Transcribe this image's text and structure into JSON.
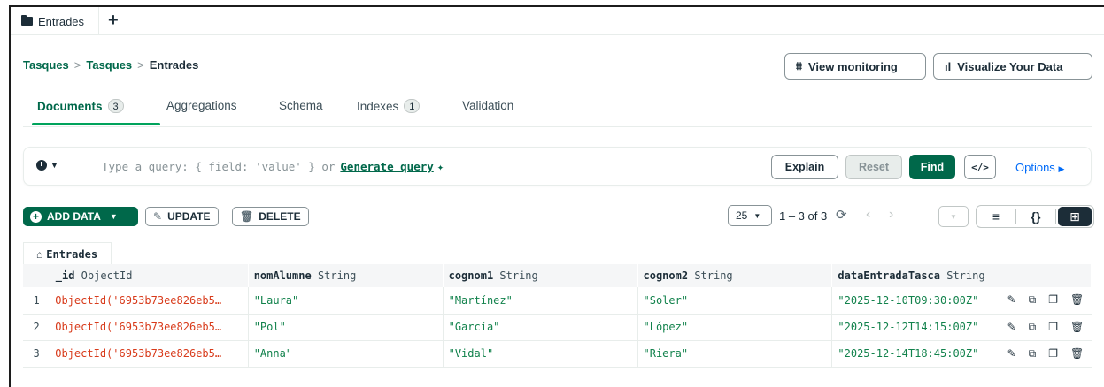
{
  "tabs": {
    "active_tab_label": "Entrades",
    "add_tab": "+"
  },
  "breadcrumb": {
    "db": "Tasques",
    "sep1": ">",
    "collection_parent": "Tasques",
    "sep2": ">",
    "current": "Entrades"
  },
  "header_buttons": {
    "monitoring": "View monitoring",
    "visualize": "Visualize Your Data"
  },
  "view_tabs": [
    {
      "label": "Documents",
      "badge": "3"
    },
    {
      "label": "Aggregations"
    },
    {
      "label": "Schema"
    },
    {
      "label": "Indexes",
      "badge": "1"
    },
    {
      "label": "Validation"
    }
  ],
  "query": {
    "placeholder": "Type a query: { field: 'value' } or",
    "generate": "Generate query",
    "explain": "Explain",
    "reset": "Reset",
    "find": "Find",
    "code": "</>",
    "options": "Options"
  },
  "actions": {
    "add_data": "ADD DATA",
    "update": "UPDATE",
    "delete": "DELETE"
  },
  "pagination": {
    "page_size": "25",
    "range": "1 – 3 of 3"
  },
  "collection_tag": "Entrades",
  "table": {
    "columns": [
      {
        "name": "_id",
        "type": "ObjectId"
      },
      {
        "name": "nomAlumne",
        "type": "String"
      },
      {
        "name": "cognom1",
        "type": "String"
      },
      {
        "name": "cognom2",
        "type": "String"
      },
      {
        "name": "dataEntradaTasca",
        "type": "String"
      }
    ],
    "rows": [
      {
        "n": "1",
        "id": "ObjectId('6953b73ee826eb5…",
        "nom": "\"Laura\"",
        "c1": "\"Martínez\"",
        "c2": "\"Soler\"",
        "date": "\"2025-12-10T09:30:00Z\""
      },
      {
        "n": "2",
        "id": "ObjectId('6953b73ee826eb5…",
        "nom": "\"Pol\"",
        "c1": "\"García\"",
        "c2": "\"López\"",
        "date": "\"2025-12-12T14:15:00Z\""
      },
      {
        "n": "3",
        "id": "ObjectId('6953b73ee826eb5…",
        "nom": "\"Anna\"",
        "c1": "\"Vidal\"",
        "c2": "\"Riera\"",
        "date": "\"2025-12-14T18:45:00Z\""
      }
    ]
  }
}
